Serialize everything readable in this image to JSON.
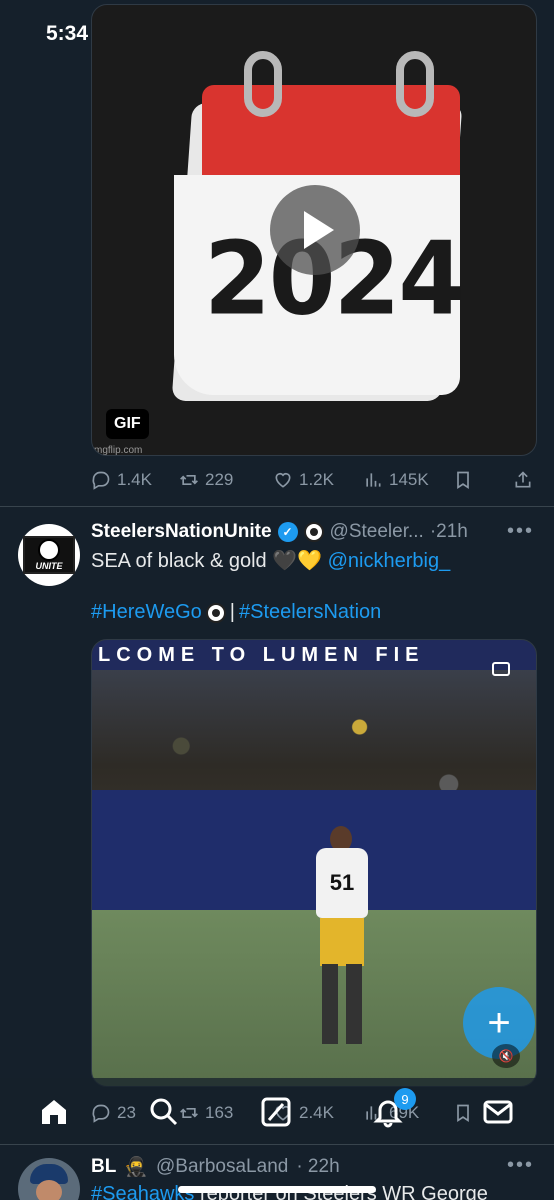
{
  "status_bar": {
    "time": "5:34"
  },
  "gif_tweet": {
    "media": {
      "year_text": "2024",
      "badge": "GIF",
      "source": "mgflip.com"
    },
    "actions": {
      "replies": "1.4K",
      "retweets": "229",
      "likes": "1.2K",
      "views": "145K"
    }
  },
  "tweet": {
    "display_name": "SteelersNationUnite",
    "handle": "@Steeler...",
    "time": "·21h",
    "text_prefix": "SEA of black & gold ",
    "emoji": "🖤💛",
    "mention": "@nickherbig_",
    "hashtag1": "#HereWeGo",
    "separator": "|",
    "hashtag2": "#SteelersNation",
    "video": {
      "banner": "LCOME TO LUMEN FIE",
      "jersey_number": "51"
    },
    "actions": {
      "replies": "23",
      "retweets": "163",
      "likes": "2.4K",
      "views": "69K"
    }
  },
  "fab_label": "+",
  "notification_count": "9",
  "next_tweet": {
    "display_name": "BL",
    "handle": "@BarbosaLand",
    "time": "· 22h",
    "hashtag": "#Seahawks",
    "text": " reporter on Steelers WR George"
  },
  "colors": {
    "background": "#15202b",
    "accent": "#1d9bf0",
    "muted": "#8b98a5"
  }
}
